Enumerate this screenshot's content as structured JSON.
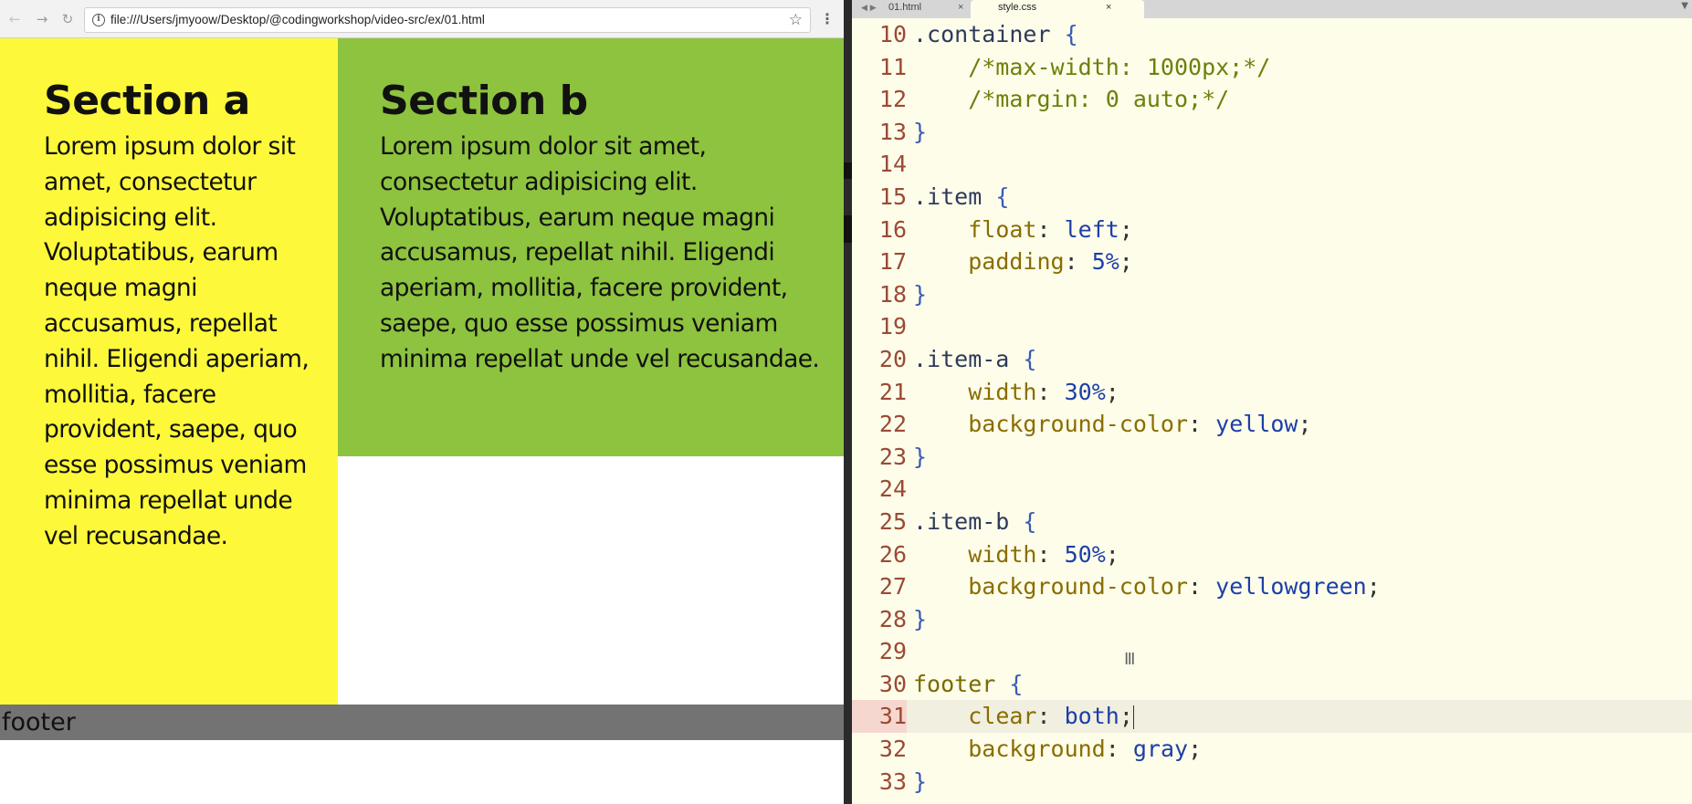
{
  "browser": {
    "url": "file:///Users/jmyoow/Desktop/@codingworkshop/video-src/ex/01.html",
    "icons": {
      "back": "arrow-left-icon",
      "forward": "arrow-right-icon",
      "reload": "reload-icon",
      "info": "info-icon",
      "bookmark": "star-icon",
      "menu": "more-vert-icon"
    }
  },
  "page": {
    "section_a": {
      "title": "Section a",
      "body": "Lorem ipsum dolor sit amet, consectetur adipisicing elit. Voluptatibus, earum neque magni accusamus, repellat nihil. Eligendi aperiam, mollitia, facere provident, saepe, quo esse possimus veniam minima repellat unde vel recusandae.",
      "background": "#fdf93a"
    },
    "section_b": {
      "title": "Section b",
      "body": "Lorem ipsum dolor sit amet, consectetur adipisicing elit. Voluptatibus, earum neque magni accusamus, repellat nihil. Eligendi aperiam, mollitia, facere provident, saepe, quo esse possimus veniam minima repellat unde vel recusandae.",
      "background": "#8dc33e"
    },
    "footer": {
      "text": "footer",
      "background": "#737373"
    }
  },
  "editor": {
    "tabs": [
      {
        "label": "01.html",
        "active": false,
        "close": "×"
      },
      {
        "label": "style.css",
        "active": true,
        "close": "×"
      }
    ],
    "active_line": 31,
    "lines": [
      {
        "n": "10",
        "tokens": [
          [
            "selector",
            ".container"
          ],
          [
            "punct",
            " "
          ],
          [
            "brace",
            "{"
          ]
        ]
      },
      {
        "n": "11",
        "tokens": [
          [
            "comment",
            "    /*max-width: 1000px;*/"
          ]
        ]
      },
      {
        "n": "12",
        "tokens": [
          [
            "comment",
            "    /*margin: 0 auto;*/"
          ]
        ]
      },
      {
        "n": "13",
        "tokens": [
          [
            "brace",
            "}"
          ]
        ]
      },
      {
        "n": "14",
        "tokens": []
      },
      {
        "n": "15",
        "tokens": [
          [
            "selector",
            ".item"
          ],
          [
            "punct",
            " "
          ],
          [
            "brace",
            "{"
          ]
        ]
      },
      {
        "n": "16",
        "tokens": [
          [
            "punct",
            "    "
          ],
          [
            "prop",
            "float"
          ],
          [
            "punct",
            ": "
          ],
          [
            "kw",
            "left"
          ],
          [
            "punct",
            ";"
          ]
        ]
      },
      {
        "n": "17",
        "tokens": [
          [
            "punct",
            "    "
          ],
          [
            "prop",
            "padding"
          ],
          [
            "punct",
            ": "
          ],
          [
            "num",
            "5%"
          ],
          [
            "punct",
            ";"
          ]
        ]
      },
      {
        "n": "18",
        "tokens": [
          [
            "brace",
            "}"
          ]
        ]
      },
      {
        "n": "19",
        "tokens": []
      },
      {
        "n": "20",
        "tokens": [
          [
            "selector",
            ".item-a"
          ],
          [
            "punct",
            " "
          ],
          [
            "brace",
            "{"
          ]
        ]
      },
      {
        "n": "21",
        "tokens": [
          [
            "punct",
            "    "
          ],
          [
            "prop",
            "width"
          ],
          [
            "punct",
            ": "
          ],
          [
            "num",
            "30%"
          ],
          [
            "punct",
            ";"
          ]
        ]
      },
      {
        "n": "22",
        "tokens": [
          [
            "punct",
            "    "
          ],
          [
            "prop",
            "background-color"
          ],
          [
            "punct",
            ": "
          ],
          [
            "kw",
            "yellow"
          ],
          [
            "punct",
            ";"
          ]
        ]
      },
      {
        "n": "23",
        "tokens": [
          [
            "brace",
            "}"
          ]
        ]
      },
      {
        "n": "24",
        "tokens": []
      },
      {
        "n": "25",
        "tokens": [
          [
            "selector",
            ".item-b"
          ],
          [
            "punct",
            " "
          ],
          [
            "brace",
            "{"
          ]
        ]
      },
      {
        "n": "26",
        "tokens": [
          [
            "punct",
            "    "
          ],
          [
            "prop",
            "width"
          ],
          [
            "punct",
            ": "
          ],
          [
            "num",
            "50%"
          ],
          [
            "punct",
            ";"
          ]
        ]
      },
      {
        "n": "27",
        "tokens": [
          [
            "punct",
            "    "
          ],
          [
            "prop",
            "background-color"
          ],
          [
            "punct",
            ": "
          ],
          [
            "kw",
            "yellowgreen"
          ],
          [
            "punct",
            ";"
          ]
        ]
      },
      {
        "n": "28",
        "tokens": [
          [
            "brace",
            "}"
          ]
        ]
      },
      {
        "n": "29",
        "tokens": []
      },
      {
        "n": "30",
        "tokens": [
          [
            "tag",
            "footer"
          ],
          [
            "punct",
            " "
          ],
          [
            "brace",
            "{"
          ]
        ]
      },
      {
        "n": "31",
        "tokens": [
          [
            "punct",
            "    "
          ],
          [
            "prop",
            "clear"
          ],
          [
            "punct",
            ": "
          ],
          [
            "kw",
            "both"
          ],
          [
            "punct",
            ";"
          ]
        ]
      },
      {
        "n": "32",
        "tokens": [
          [
            "punct",
            "    "
          ],
          [
            "prop",
            "background"
          ],
          [
            "punct",
            ": "
          ],
          [
            "kw",
            "gray"
          ],
          [
            "punct",
            ";"
          ]
        ]
      },
      {
        "n": "33",
        "tokens": [
          [
            "brace",
            "}"
          ]
        ]
      }
    ]
  }
}
